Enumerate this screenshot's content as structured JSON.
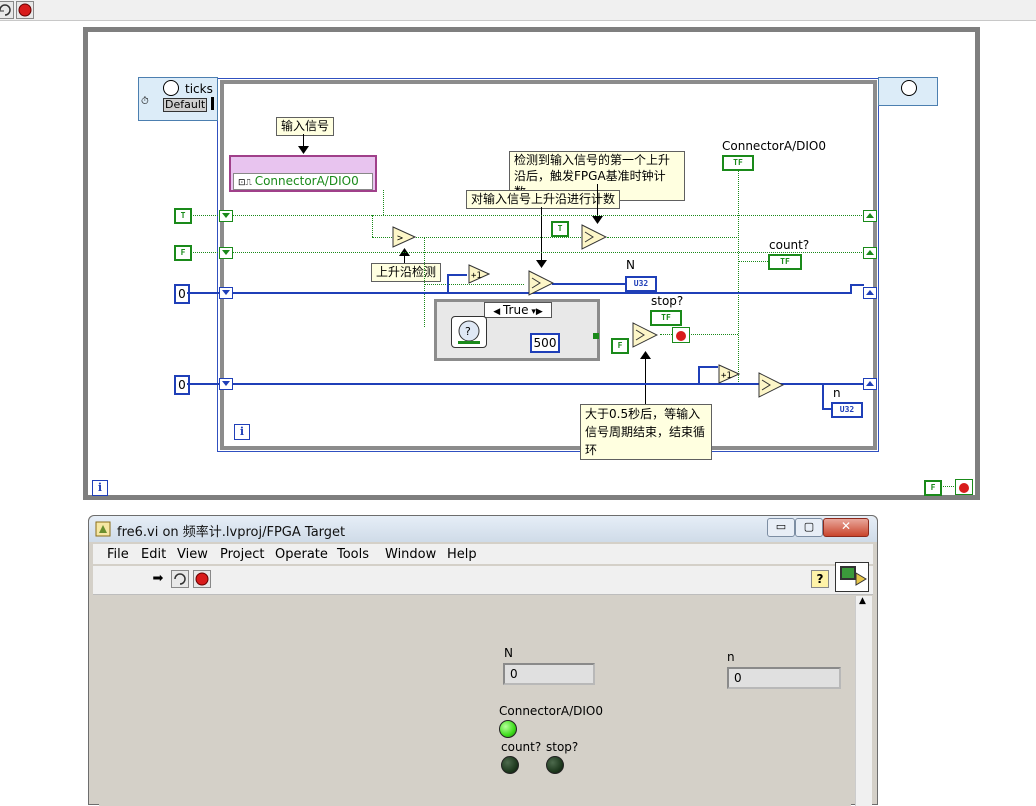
{
  "top_toolbar": {
    "run_continuous_icon": "run-continuously-icon",
    "abort_icon": "abort-icon"
  },
  "block_diagram": {
    "ticks_label": "ticks",
    "timing_default": "Default",
    "notes": {
      "input_signal": "输入信号",
      "detect_first_rising": "检测到输入信号的第一个上升沿后，触发FPGA基准时钟计数。",
      "count_rising": "对输入信号上升沿进行计数",
      "rising_detect": "上升沿检测",
      "after_half_second": "大于0.5秒后，等输入信号周期结束，结束循环"
    },
    "io_node_label": "ConnectorA/DIO0",
    "connector_label": "ConnectorA/DIO0",
    "count_label": "count?",
    "stop_label": "stop?",
    "N_label": "N",
    "n_label": "n",
    "case_selector": "True",
    "const_500": "500",
    "const_zero_1": "0",
    "const_zero_2": "0",
    "bool_T": "T",
    "bool_F": "F",
    "tf": "TF",
    "u32": "U32",
    "plus_one": "+1",
    "info": "i"
  },
  "front_panel": {
    "title": "fre6.vi on 频率计.lvproj/FPGA Target",
    "menu": [
      "File",
      "Edit",
      "View",
      "Project",
      "Operate",
      "Tools",
      "Window",
      "Help"
    ],
    "N_label": "N",
    "N_value": "0",
    "n_label": "n",
    "n_value": "0",
    "connector_label": "ConnectorA/DIO0",
    "count_label": "count?",
    "stop_label": "stop?",
    "led_on_color": "#3ddc1a",
    "led_off_color": "#1f3a1f"
  }
}
